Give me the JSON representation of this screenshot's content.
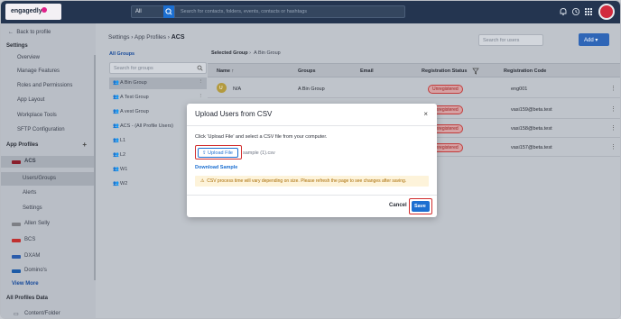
{
  "topbar": {
    "logo_text": "engagedly",
    "scope_value": "All",
    "search_placeholder": "Search for contacts, folders, events, contacts or hashtags"
  },
  "sidebar": {
    "back_label": "Back to profile",
    "settings_header": "Settings",
    "settings_items": [
      "Overview",
      "Manage Features",
      "Roles and Permissions",
      "App Layout",
      "Workplace Tools",
      "SFTP Configuration"
    ],
    "profiles_header": "App Profiles",
    "profile_acs": "ACS",
    "acs_items": [
      "Users/Groups",
      "Alerts",
      "Settings"
    ],
    "other_profiles": [
      "Allen Selly",
      "BCS",
      "DXAM",
      "Domino's"
    ],
    "view_more": "View More",
    "all_profiles_data": "All Profiles Data",
    "content_folder": "Content/Folder"
  },
  "main": {
    "breadcrumb_path": "Settings  ›  App Profiles  › ",
    "breadcrumb_current": "ACS",
    "users_search_placeholder": "Search for users",
    "add_button": "Add ▾",
    "groups_title": "All Groups",
    "groups_search_placeholder": "Search for groups",
    "groups": [
      "A Bin Group",
      "A Test Group",
      "A vest Group",
      "ACS - (All Profile Users)",
      "L1",
      "L2",
      "W1",
      "W2"
    ],
    "selected_group_label": "Selected Group",
    "selected_group_value": "A Bin Group",
    "table": {
      "headers": [
        "Name",
        "Groups",
        "Email",
        "Registration Status",
        "Registration Code"
      ],
      "sort_arrow": "↑",
      "rows": [
        {
          "initial": "U",
          "name": "N/A",
          "group": "A Bin Group",
          "status": "Unregistered",
          "code": "eng001"
        },
        {
          "initial": "",
          "name": "",
          "group": "",
          "status": "Unregistered",
          "code": "vasi159@beta.test"
        },
        {
          "initial": "",
          "name": "",
          "group": "",
          "status": "Unregistered",
          "code": "vasi158@beta.test"
        },
        {
          "initial": "",
          "name": "",
          "group": "",
          "status": "Unregistered",
          "code": "vasi157@beta.test"
        }
      ]
    }
  },
  "modal": {
    "title": "Upload Users from CSV",
    "instruction": "Click 'Upload File' and select a CSV file from your computer.",
    "upload_label": "Upload File",
    "file_name": "sample (1).csv",
    "download_link": "Download Sample",
    "warning": "CSV process time will vary depending on size.  Please refresh the page to see changes after saving.",
    "cancel_label": "Cancel",
    "save_label": "Save"
  },
  "colors": {
    "topbar": "#243550",
    "accent": "#1c6fd1",
    "highlight": "#d12c2c",
    "warning_bg": "#fdf3da"
  }
}
